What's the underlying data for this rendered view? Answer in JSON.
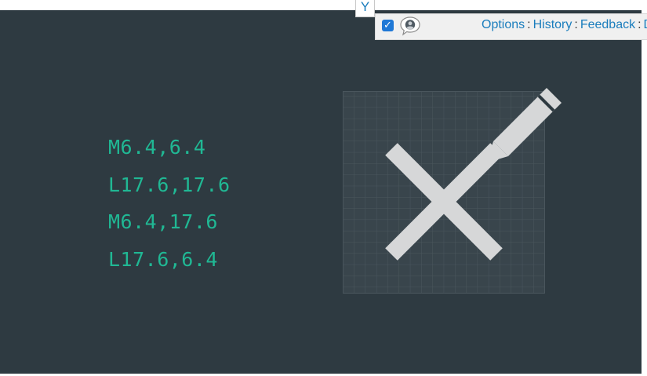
{
  "banner": {
    "path_commands": [
      "M6.4,6.4",
      "L17.6,17.6",
      "M6.4,17.6",
      "L17.6,6.4"
    ],
    "illustration_icon": "close-x-with-pencil-icon",
    "colors": {
      "background": "#2e3a41",
      "code_text": "#20b894",
      "grid_panel": "#39454c",
      "glyph": "#d6d7d8"
    }
  },
  "tab": {
    "label": "Y"
  },
  "toolbar": {
    "checkbox_checked": true,
    "links": {
      "options": "Options",
      "history": "History",
      "feedback": "Feedback",
      "truncated": "D"
    },
    "separator": ":"
  }
}
